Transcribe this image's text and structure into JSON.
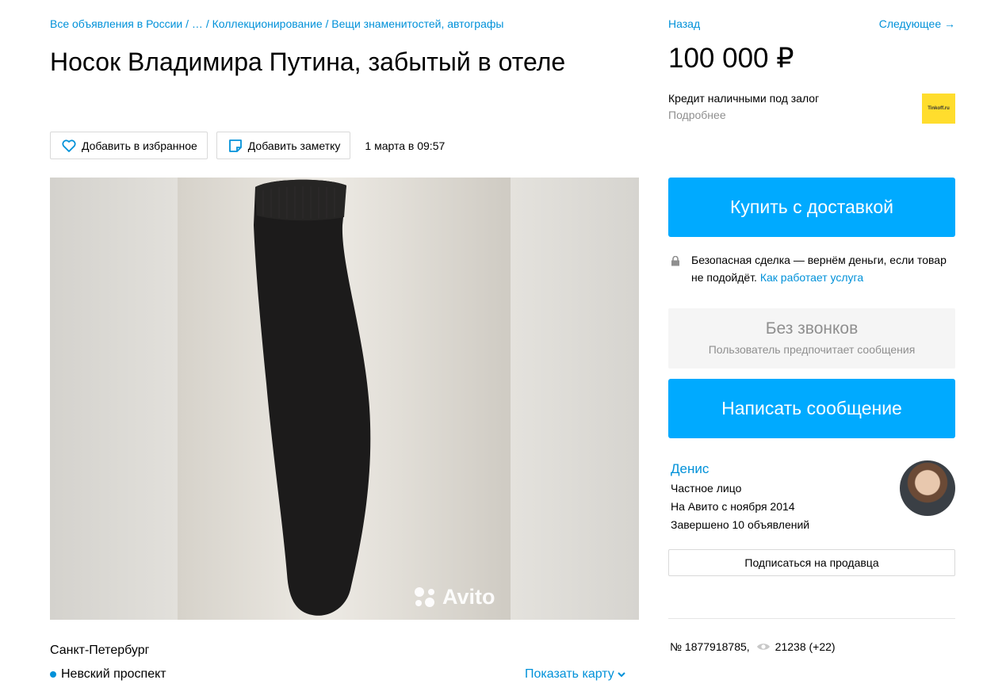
{
  "breadcrumb": "Все объявления в России / … / Коллекционирование / Вещи знаменитостей, автографы",
  "title": "Носок Владимира Путина, забытый в отеле",
  "actions": {
    "favorite_label": "Добавить в избранное",
    "note_label": "Добавить заметку",
    "date": "1 марта в 09:57"
  },
  "gallery": {
    "watermark": "Avito"
  },
  "location": {
    "city": "Санкт-Петербург",
    "metro": "Невский проспект",
    "show_map": "Показать карту"
  },
  "nav": {
    "back": "Назад",
    "next": "Следующее →"
  },
  "price": "100 000 ₽",
  "credit": {
    "title": "Кредит наличными под залог",
    "more": "Подробнее",
    "logo_text": "Tinkoff.ru"
  },
  "buy_button": "Купить с доставкой",
  "safe_deal": {
    "text": "Безопасная сделка — вернём деньги, если товар не подойдёт.",
    "link": "Как работает услуга"
  },
  "no_calls": {
    "title": "Без звонков",
    "subtitle": "Пользователь предпочитает сообщения"
  },
  "message_button": "Написать сообщение",
  "seller": {
    "name": "Денис",
    "type": "Частное лицо",
    "since": "На Авито с ноября 2014",
    "completed": "Завершено 10 объявлений",
    "subscribe": "Подписаться на продавца"
  },
  "stats": {
    "id": "№ 1877918785,",
    "views": "21238 (+22)"
  },
  "colors": {
    "link": "#0091d9",
    "primary_button": "#00aaff",
    "sock": "#1c1b1b"
  }
}
